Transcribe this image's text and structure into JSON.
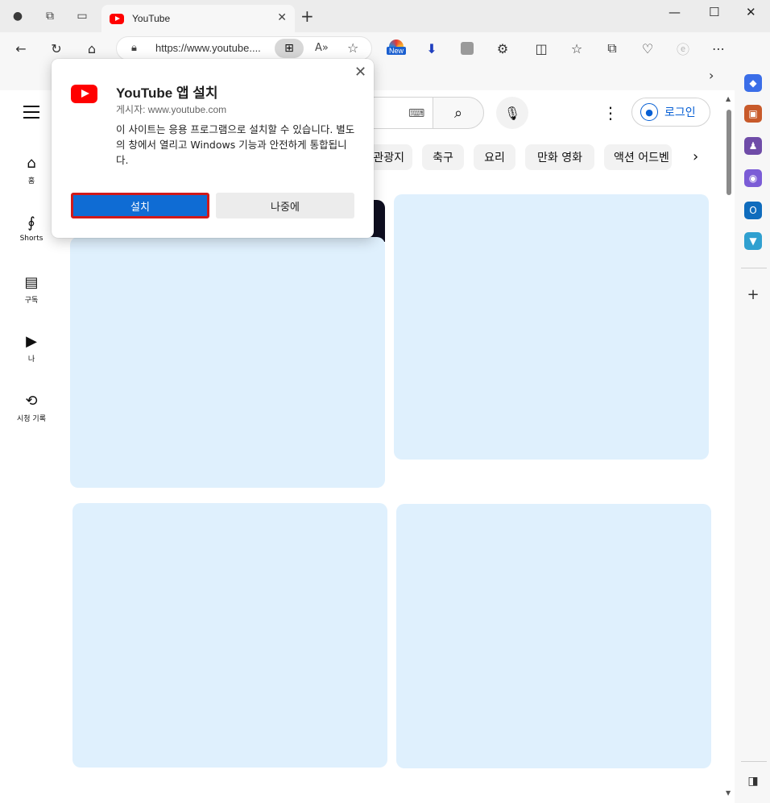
{
  "browser": {
    "tab_title": "YouTube",
    "url": "https://www.youtube....",
    "new_badge": "New"
  },
  "youtube": {
    "nav": [
      {
        "label": "홈",
        "icon": "home-icon"
      },
      {
        "label": "Shorts",
        "icon": "shorts-icon"
      },
      {
        "label": "구독",
        "icon": "subscriptions-icon"
      },
      {
        "label": "나",
        "icon": "you-icon"
      },
      {
        "label": "시청 기록",
        "icon": "history-icon"
      }
    ],
    "login_label": "로그인",
    "chips": [
      "관광지",
      "축구",
      "요리",
      "만화 영화",
      "액션 어드벤"
    ]
  },
  "dialog": {
    "title": "YouTube 앱 설치",
    "publisher": "게시자: www.youtube.com",
    "description": "이 사이트는 응용 프로그램으로 설치할 수 있습니다. 별도의 창에서 열리고 Windows 기능과 안전하게 통합됩니다.",
    "install_label": "설치",
    "later_label": "나중에"
  },
  "colors": {
    "install_button": "#0f6cd4",
    "highlight_border": "#d11a1a",
    "youtube_red": "#ff0000",
    "card_placeholder": "#dff0fd"
  }
}
